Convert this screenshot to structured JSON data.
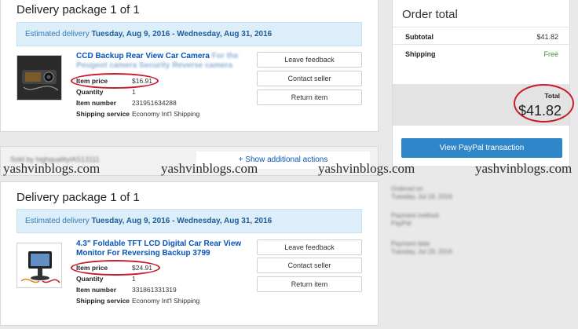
{
  "packages": [
    {
      "title": "Delivery package 1 of 1",
      "est_prefix": "Estimated delivery",
      "est_dates": "Tuesday, Aug 9, 2016 - Wednesday, Aug 31, 2016",
      "product_title": "CCD Backup Rear View Car Camera",
      "product_title_blur": "For the Peugeot camera Security Reverse camera",
      "details": [
        {
          "label": "Item price",
          "value": "$16.91"
        },
        {
          "label": "Quantity",
          "value": "1"
        },
        {
          "label": "Item number",
          "value": "231951634288"
        },
        {
          "label": "Shipping service",
          "value": "Economy Int'l Shipping"
        }
      ],
      "buttons": [
        "Leave feedback",
        "Contact seller",
        "Return item"
      ]
    },
    {
      "title": "Delivery package 1 of 1",
      "est_prefix": "Estimated delivery",
      "est_dates": "Tuesday, Aug 9, 2016 - Wednesday, Aug 31, 2016",
      "product_title": "4.3\" Foldable TFT LCD Digital Car Rear View Monitor For Reversing Backup 3799",
      "product_title_blur": "",
      "details": [
        {
          "label": "Item price",
          "value": "$24.91"
        },
        {
          "label": "Quantity",
          "value": "1"
        },
        {
          "label": "Item number",
          "value": "331861331319"
        },
        {
          "label": "Shipping service",
          "value": "Economy Int'l Shipping"
        }
      ],
      "buttons": [
        "Leave feedback",
        "Contact seller",
        "Return item"
      ]
    }
  ],
  "strip": {
    "blurred_text": "Sold by highqualityIAS13111",
    "show_actions": "+ Show additional actions"
  },
  "order_total": {
    "title": "Order total",
    "subtotal_label": "Subtotal",
    "subtotal_value": "$41.82",
    "shipping_label": "Shipping",
    "shipping_value": "Free",
    "total_label": "Total",
    "total_value": "$41.82",
    "paypal_button": "View PayPal transaction"
  },
  "side_info": [
    {
      "label": "Ordered on",
      "value": "Tuesday, Jul 19, 2016"
    },
    {
      "label": "Payment method",
      "value": "PayPal"
    },
    {
      "label": "Payment date",
      "value": "Tuesday, Jul 19, 2016"
    }
  ],
  "watermarks": [
    "yashvinblogs.com",
    "yashvinblogs.com",
    "yashvinblogs.com",
    "yashvinblogs.com"
  ],
  "colors": {
    "accent_blue": "#0654ba",
    "highlight_red": "#c81a2a",
    "paypal_blue": "#2f86c8",
    "free_green": "#3a9a2f"
  }
}
